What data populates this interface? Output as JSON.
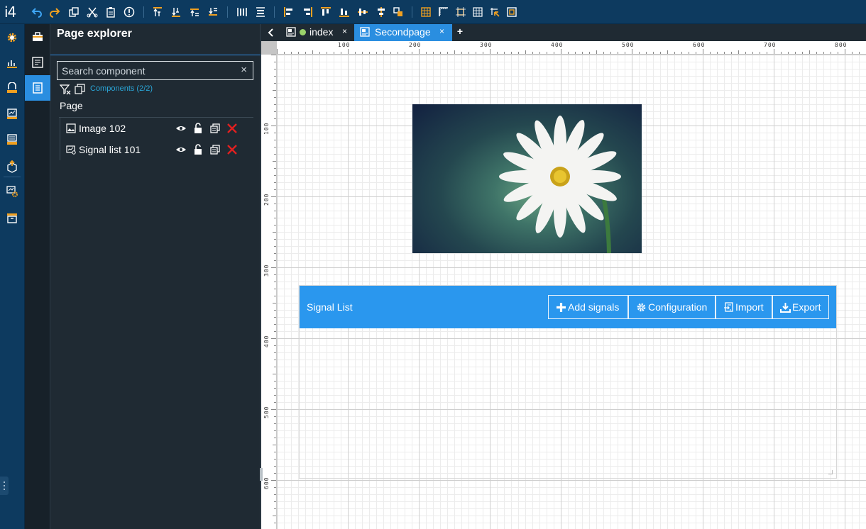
{
  "app": {
    "logo": "i4"
  },
  "explorer": {
    "title": "Page explorer",
    "search_placeholder": "Search component",
    "clear_symbol": "×",
    "components_count": "Components (2/2)",
    "page_label": "Page",
    "items": [
      {
        "label": "Image 102",
        "icon": "image-icon"
      },
      {
        "label": "Signal list 101",
        "icon": "signal-list-icon"
      }
    ]
  },
  "tabs": {
    "back_icon": "chevron-left-icon",
    "items": [
      {
        "label": "index",
        "close": "×",
        "status_color": "#9bd36a",
        "active": false
      },
      {
        "label": "Secondpage",
        "close": "×",
        "active": true
      }
    ],
    "add_label": "+"
  },
  "rulers": {
    "horizontal": [
      "100",
      "200",
      "300",
      "400",
      "500",
      "600",
      "700",
      "800"
    ],
    "vertical": [
      "100",
      "200",
      "300",
      "400",
      "500",
      "600"
    ]
  },
  "signal_list": {
    "title": "Signal List",
    "buttons": [
      {
        "label": "Add signals",
        "icon": "plus-icon"
      },
      {
        "label": "Configuration",
        "icon": "gear-icon"
      },
      {
        "label": "Import",
        "icon": "import-icon"
      },
      {
        "label": "Export",
        "icon": "export-icon"
      }
    ]
  },
  "colors": {
    "topbar": "#0d3a5f",
    "accent": "#2a8ee0",
    "signal_header": "#2a97ee",
    "toolbar_icon_orange": "#f0a020",
    "delete_red": "#e02020"
  }
}
